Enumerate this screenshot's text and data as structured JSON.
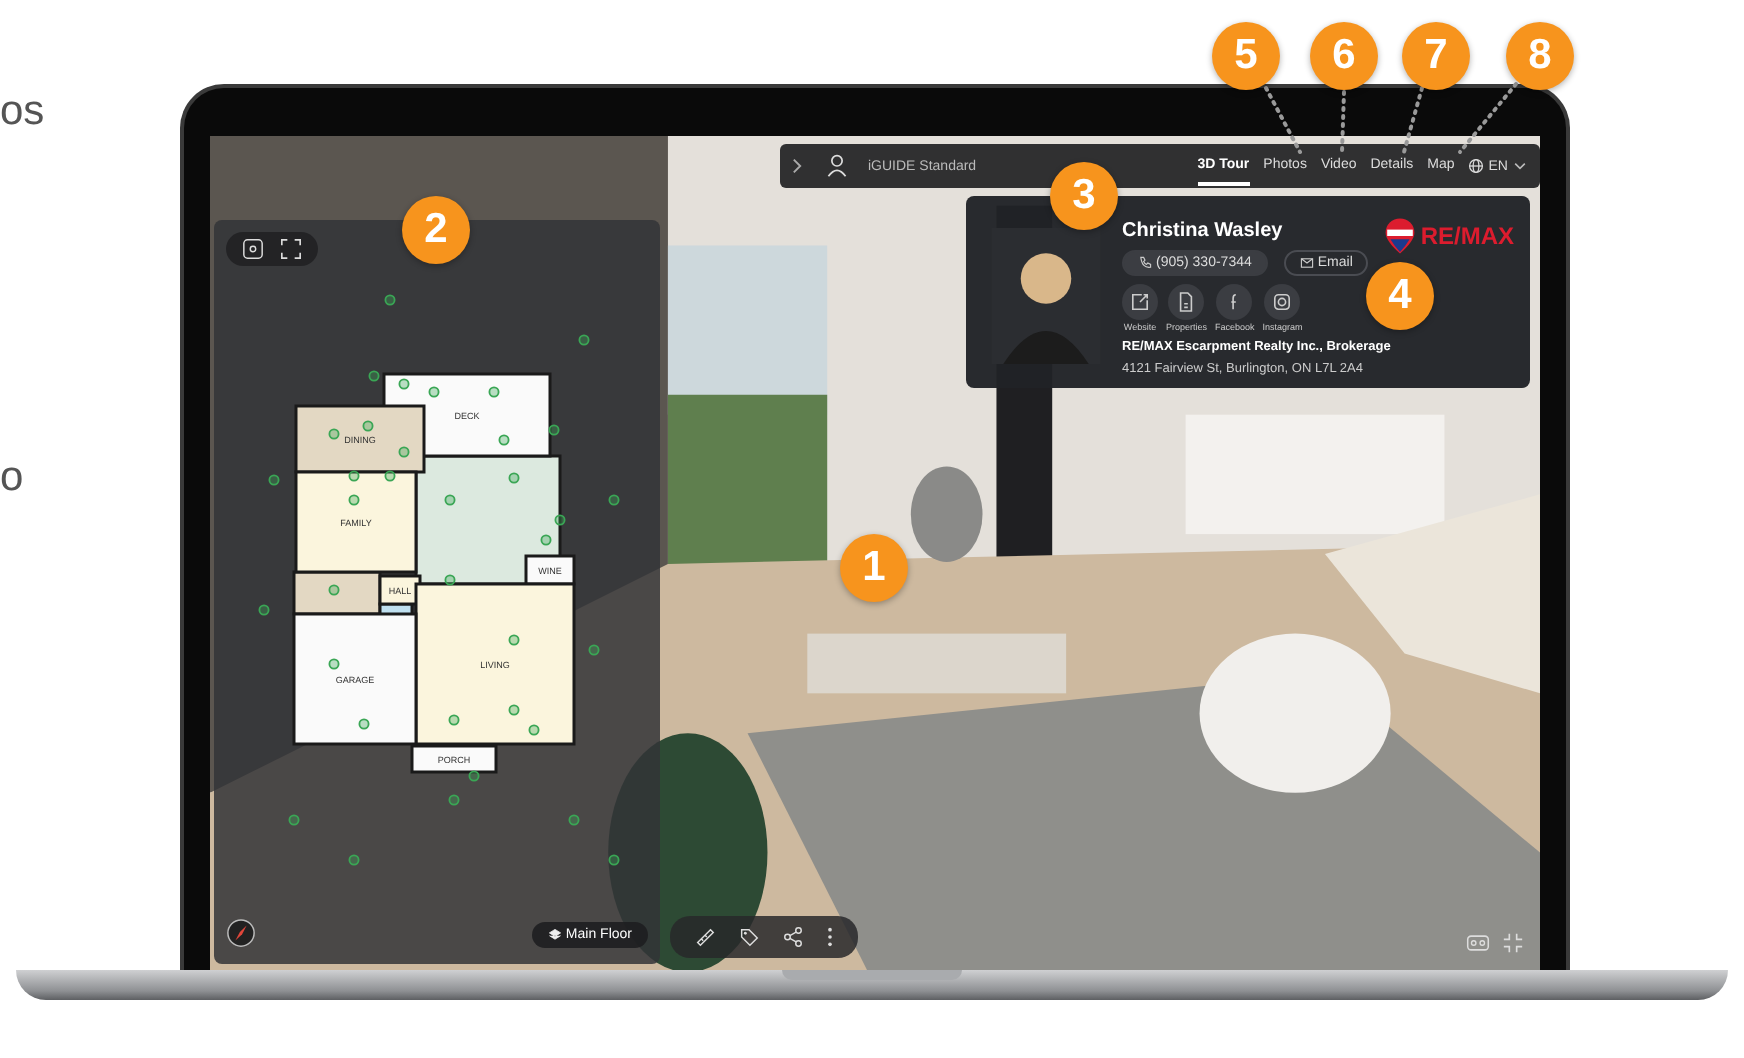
{
  "side_text": [
    "os",
    "o"
  ],
  "nav": {
    "title": "iGUIDE Standard",
    "tabs": [
      {
        "label": "3D Tour",
        "selected": true
      },
      {
        "label": "Photos",
        "selected": false
      },
      {
        "label": "Video",
        "selected": false
      },
      {
        "label": "Details",
        "selected": false
      },
      {
        "label": "Map",
        "selected": false
      }
    ],
    "language": "EN"
  },
  "agent": {
    "name": "Christina Wasley",
    "phone": "(905) 330-7344",
    "email": "Email",
    "logo": "RE/MAX",
    "links": [
      {
        "label": "Website",
        "kind": "website"
      },
      {
        "label": "Properties",
        "kind": "properties"
      },
      {
        "label": "Facebook",
        "kind": "facebook"
      },
      {
        "label": "Instagram",
        "kind": "instagram"
      }
    ],
    "company": "RE/MAX Escarpment Realty Inc., Brokerage",
    "address": "4121 Fairview St, Burlington, ON L7L 2A4"
  },
  "floor_plan": {
    "rooms": [
      {
        "label": "DECK"
      },
      {
        "label": "DINING"
      },
      {
        "label": "FAMILY"
      },
      {
        "label": "HALL"
      },
      {
        "label": "WINE"
      },
      {
        "label": "LIVING"
      },
      {
        "label": "GARAGE"
      },
      {
        "label": "PORCH"
      }
    ],
    "floor": "Main Floor"
  },
  "callouts": [
    {
      "label": "1"
    },
    {
      "label": "2"
    },
    {
      "label": "3"
    },
    {
      "label": "4"
    },
    {
      "label": "5"
    },
    {
      "label": "6"
    },
    {
      "label": "7"
    },
    {
      "label": "8"
    }
  ]
}
